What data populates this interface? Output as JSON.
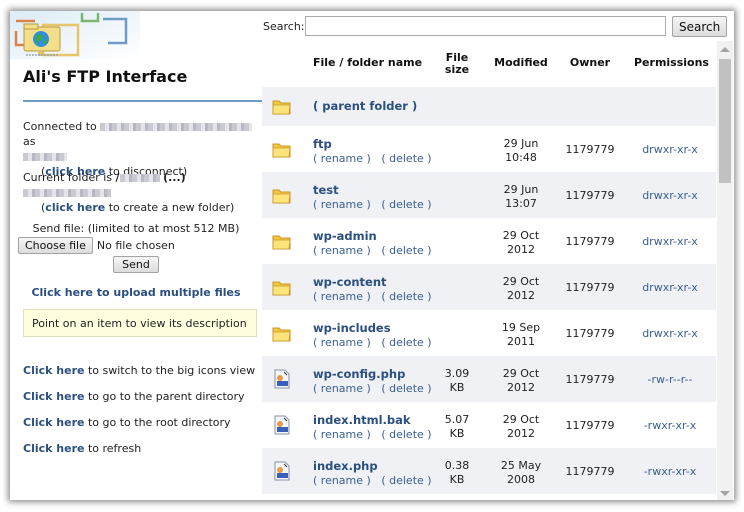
{
  "sidebar": {
    "title": "Ali's FTP Interface",
    "connected_prefix": "Connected to",
    "connected_as": "as",
    "disconnect_link": "click here",
    "disconnect_suffix": "to disconnect)",
    "paren_open": "(",
    "current_folder_prefix": "Current folder is",
    "current_folder_slash": "/",
    "current_folder_more": "(...)",
    "create_link": "click here",
    "create_suffix": "to create a new folder)",
    "send_label": "Send file: (limited to at most 512 MB)",
    "choose_file": "Choose file",
    "no_file": "No file chosen",
    "send_button": "Send",
    "upload_multiple": "Click here to upload multiple files",
    "description_hint": "Point on an item to view its description",
    "nav_links": [
      {
        "link": "Click here",
        "text": "to switch to the big icons view"
      },
      {
        "link": "Click here",
        "text": "to go to the parent directory"
      },
      {
        "link": "Click here",
        "text": "to go to the root directory"
      },
      {
        "link": "Click here",
        "text": "to refresh"
      }
    ]
  },
  "search": {
    "label": "Search:",
    "value": "",
    "button": "Search"
  },
  "table": {
    "headers": {
      "name": "File / folder name",
      "size_line1": "File",
      "size_line2": "size",
      "modified": "Modified",
      "owner": "Owner",
      "permissions": "Permissions"
    },
    "rename_label": "( rename )",
    "delete_label": "( delete )",
    "parent_folder": "( parent folder )",
    "rows": [
      {
        "type": "folder",
        "name": "ftp",
        "size1": "",
        "size2": "",
        "mod1": "29 Jun",
        "mod2": "10:48",
        "owner": "1179779",
        "perm": "drwxr-xr-x"
      },
      {
        "type": "folder",
        "name": "test",
        "size1": "",
        "size2": "",
        "mod1": "29 Jun",
        "mod2": "13:07",
        "owner": "1179779",
        "perm": "drwxr-xr-x"
      },
      {
        "type": "folder",
        "name": "wp-admin",
        "size1": "",
        "size2": "",
        "mod1": "29 Oct",
        "mod2": "2012",
        "owner": "1179779",
        "perm": "drwxr-xr-x"
      },
      {
        "type": "folder",
        "name": "wp-content",
        "size1": "",
        "size2": "",
        "mod1": "29 Oct",
        "mod2": "2012",
        "owner": "1179779",
        "perm": "drwxr-xr-x"
      },
      {
        "type": "folder",
        "name": "wp-includes",
        "size1": "",
        "size2": "",
        "mod1": "19 Sep",
        "mod2": "2011",
        "owner": "1179779",
        "perm": "drwxr-xr-x"
      },
      {
        "type": "file",
        "name": "wp-config.php",
        "size1": "3.09",
        "size2": "KB",
        "mod1": "29 Oct",
        "mod2": "2012",
        "owner": "1179779",
        "perm": "-rw-r--r--"
      },
      {
        "type": "file",
        "name": "index.html.bak",
        "size1": "5.07",
        "size2": "KB",
        "mod1": "29 Oct",
        "mod2": "2012",
        "owner": "1179779",
        "perm": "-rwxr-xr-x"
      },
      {
        "type": "file",
        "name": "index.php",
        "size1": "0.38",
        "size2": "KB",
        "mod1": "25 May",
        "mod2": "2008",
        "owner": "1179779",
        "perm": "-rwxr-xr-x"
      }
    ]
  },
  "colors": {
    "link": "#2b4f80",
    "accent_rule": "#6f9cc5",
    "row_alt": "#eff1f4",
    "description_bg": "#ffffe0"
  }
}
